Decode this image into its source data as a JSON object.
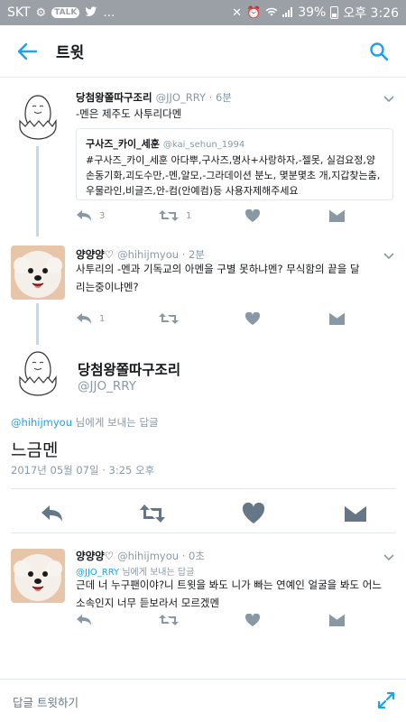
{
  "status_bar": {
    "carrier": "SKT",
    "battery": "39%",
    "time": "오후 3:26"
  },
  "app_bar": {
    "title": "트윗"
  },
  "tweets": [
    {
      "name": "당첨왕쫄따구조리",
      "handle": "@JJO_RRY · 6분",
      "text": "-멘은 제주도 사투리다멘",
      "quote": {
        "name": "구사즈_카이_세훈",
        "handle": "@kai_sehun_1994",
        "text": "#구사즈_카이_세훈 아다뿌,구사즈,명사+사랑하자,-젤못, 실검요정,양손동기화,괴도수만,-멘,알모,-그라데이션 분노, 몇분몇초 개,지갑찾는춤,우물라인,비글즈,안-컴(안예컴)등 사용자제해주세요"
      },
      "replies": "3",
      "retweets": "1"
    },
    {
      "name": "양양양♡",
      "handle": "@hihijmyou · 2분",
      "text": "사투리의 -멘과 기독교의 아멘을 구별 못하냐멘? 무식함의 끝을 달리는중이냐멘?",
      "replies": "1"
    }
  ],
  "main_tweet": {
    "name": "당첨왕쫄따구조리",
    "handle": "@JJO_RRY",
    "reply_to_mention": "@hihijmyou",
    "reply_to_suffix": " 님에게 보내는 답글",
    "text": "느금멘",
    "timestamp": "2017년 05월 07일 · 3:25 오후"
  },
  "reply_tweet": {
    "name": "양양양♡",
    "handle": "@hihijmyou · 0초",
    "reply_to_mention": "@JJO_RRY",
    "reply_to_suffix": " 님에게 보내는 답글",
    "text": "근데 너 누구팬이야?니 트윗을 봐도 니가 빠는 연예인 얼굴을 봐도 어느 소속인지 너무 듣보라서 모르겠멘"
  },
  "compose": {
    "label": "답글 트윗하기"
  },
  "colors": {
    "accent": "#1da1f2",
    "icon_gray": "#8899a6",
    "action_dark": "#657786"
  },
  "icons": [
    "back-arrow-icon",
    "search-icon",
    "reply-icon",
    "retweet-icon",
    "like-icon",
    "dm-icon",
    "chevron-down-icon",
    "expand-icon"
  ]
}
